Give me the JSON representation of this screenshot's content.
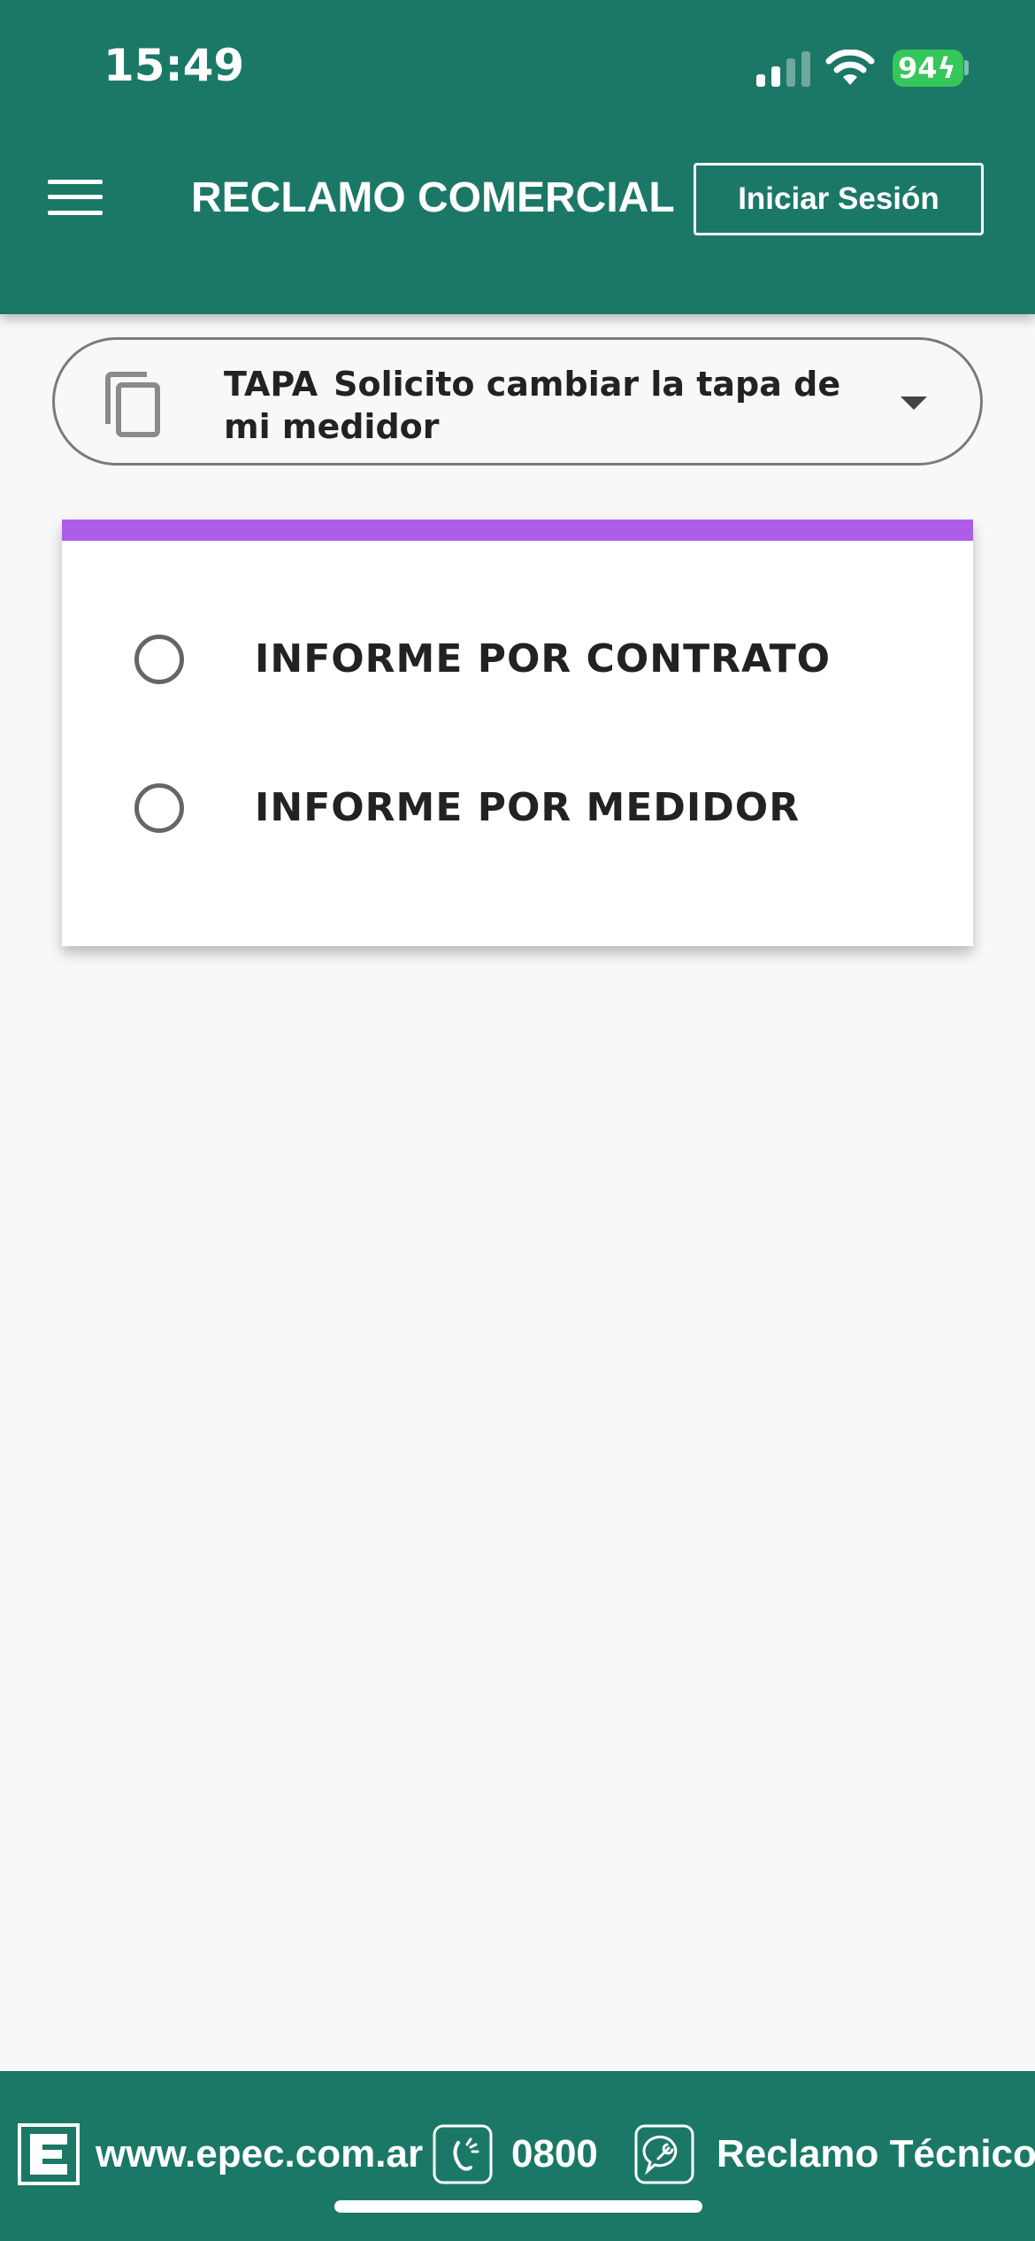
{
  "status_bar": {
    "time": "15:49",
    "battery": "94",
    "icons": [
      "signal-icon",
      "wifi-icon",
      "battery-icon"
    ]
  },
  "header": {
    "title": "RECLAMO COMERCIAL",
    "login_label": "Iniciar Sesión",
    "menu_icon": "hamburger-menu-icon",
    "background_color": "#1c7866"
  },
  "claim_select": {
    "code": "TAPA",
    "text": "Solicito cambiar la tapa de mi medidor",
    "icon": "copy-icon",
    "dropdown_icon": "caret-down-icon"
  },
  "report_options": {
    "accent_color": "#ae5de9",
    "options": [
      {
        "label": "INFORME POR CONTRATO",
        "selected": false
      },
      {
        "label": "INFORME POR MEDIDOR",
        "selected": false
      }
    ]
  },
  "footer": {
    "website": "www.epec.com.ar",
    "phone": "0800",
    "technical_claim": "Reclamo Técnico",
    "icons": [
      "epec-logo-icon",
      "phone-icon",
      "chat-wrench-icon"
    ]
  }
}
